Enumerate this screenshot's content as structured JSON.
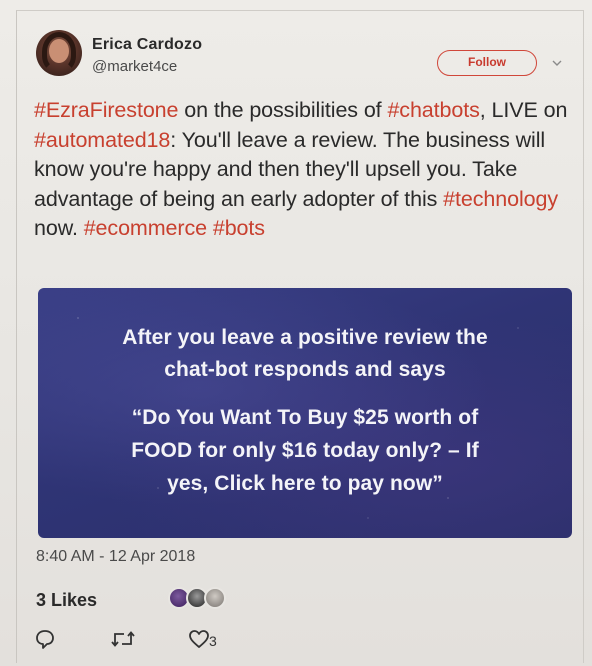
{
  "author": {
    "name": "Erica Cardozo",
    "handle": "@market4ce",
    "follow_label": "Follow",
    "menu_icon": "chevron-down-icon"
  },
  "tweet": {
    "segments": [
      {
        "text": "#EzraFirestone",
        "tag": true
      },
      {
        "text": " on the possibilities of ",
        "tag": false
      },
      {
        "text": "#chatbots",
        "tag": true
      },
      {
        "text": ", LIVE on ",
        "tag": false
      },
      {
        "text": "#automated18",
        "tag": true
      },
      {
        "text": ": You'll leave a review. The business will know you're happy and then they'll upsell you. Take advantage of being an early adopter of this ",
        "tag": false
      },
      {
        "text": "#technology",
        "tag": true
      },
      {
        "text": " now. ",
        "tag": false
      },
      {
        "text": "#ecommerce",
        "tag": true
      },
      {
        "text": " ",
        "tag": false
      },
      {
        "text": "#bots",
        "tag": true
      }
    ],
    "hashtag_color": "#c8402f"
  },
  "media": {
    "lines": [
      "After you leave a positive review the",
      "chat-bot responds and says",
      "“Do You Want To Buy $25 worth of",
      "FOOD for only $16 today only? – If",
      "yes, Click here to pay now”"
    ],
    "background_color": "#2f3475"
  },
  "meta": {
    "timestamp": "8:40 AM - 12 Apr 2018",
    "likes_count": "3",
    "likes_label": "Likes"
  },
  "actions": {
    "reply_icon": "reply-icon",
    "retweet_icon": "retweet-icon",
    "like_icon": "heart-icon",
    "like_count": "3"
  }
}
